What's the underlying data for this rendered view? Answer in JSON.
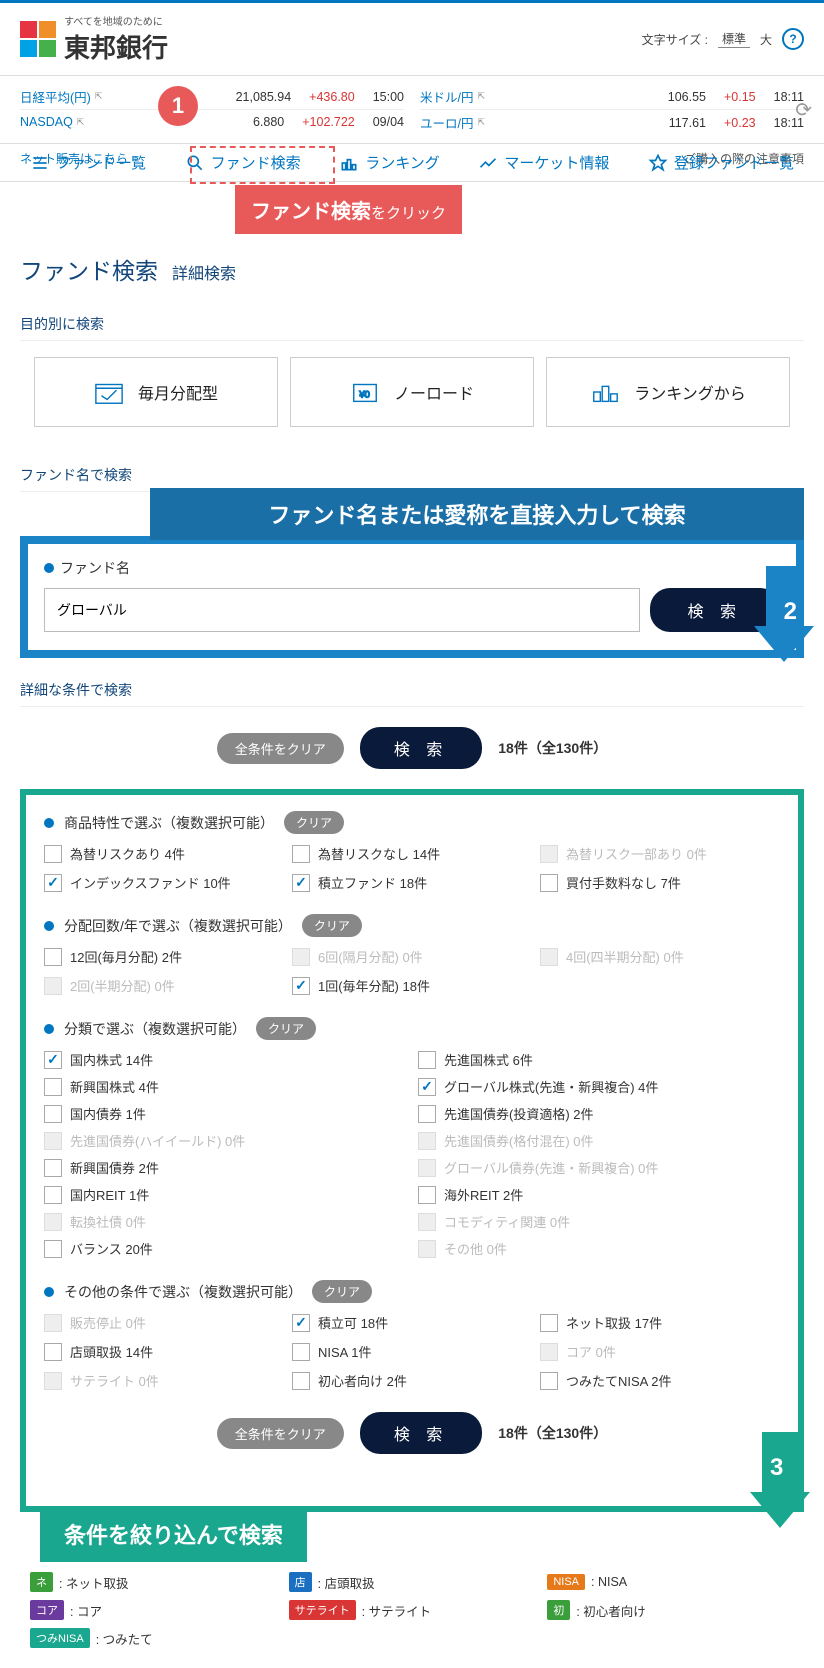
{
  "header": {
    "subtitle": "すべてを地域のために",
    "bank": "東邦銀行",
    "text_size_label": "文字サイズ :",
    "std": "標準",
    "large": "大"
  },
  "market": {
    "rows_left": [
      {
        "name": "日経平均(円)",
        "val": "21,085.94",
        "chg": "+436.80",
        "time": "15:00"
      },
      {
        "name": "NASDAQ",
        "val": "6.880",
        "chg": "+102.722",
        "time": "09/04"
      }
    ],
    "rows_right": [
      {
        "name": "米ドル/円",
        "val": "106.55",
        "chg": "+0.15",
        "time": "18:11"
      },
      {
        "name": "ユーロ/円",
        "val": "117.61",
        "chg": "+0.23",
        "time": "18:11"
      }
    ]
  },
  "nav": {
    "items": [
      "ファンド一覧",
      "ファンド検索",
      "ランキング",
      "マーケット情報",
      "登録ファンド一覧"
    ]
  },
  "annot": {
    "n1": "1",
    "callout1_a": "ファンド検索",
    "callout1_b": "をクリック",
    "callout2": "ファンド名または愛称を直接入力して検索",
    "n2": "2",
    "callout3": "条件を絞り込んで検索",
    "n3": "3"
  },
  "subbar": {
    "left": "ネット販売はこちら",
    "right": "ご購入の際の注意事項"
  },
  "titles": {
    "h1": "ファンド検索",
    "h1sub": "詳細検索",
    "purpose": "目的別に検索",
    "byname": "ファンド名で検索",
    "detail": "詳細な条件で検索"
  },
  "purpose": {
    "p1": "毎月分配型",
    "p2": "ノーロード",
    "p3": "ランキングから"
  },
  "fundname": {
    "label": "ファンド名",
    "value": "グローバル",
    "btn": "検 索"
  },
  "actions": {
    "clear": "全条件をクリア",
    "search": "検 索",
    "count": "18件（全130件）"
  },
  "filters": {
    "g1": {
      "title": "商品特性で選ぶ（複数選択可能）",
      "clr": "クリア",
      "opts": [
        {
          "t": "為替リスクあり  4件",
          "c": false,
          "d": false
        },
        {
          "t": "為替リスクなし  14件",
          "c": false,
          "d": false
        },
        {
          "t": "為替リスク一部あり  0件",
          "c": false,
          "d": true
        },
        {
          "t": "インデックスファンド  10件",
          "c": true,
          "d": false
        },
        {
          "t": "積立ファンド  18件",
          "c": true,
          "d": false
        },
        {
          "t": "買付手数料なし  7件",
          "c": false,
          "d": false
        }
      ]
    },
    "g2": {
      "title": "分配回数/年で選ぶ（複数選択可能）",
      "clr": "クリア",
      "opts": [
        {
          "t": "12回(毎月分配)  2件",
          "c": false,
          "d": false
        },
        {
          "t": "6回(隔月分配)  0件",
          "c": false,
          "d": true
        },
        {
          "t": "4回(四半期分配)  0件",
          "c": false,
          "d": true
        },
        {
          "t": "2回(半期分配)  0件",
          "c": false,
          "d": true
        },
        {
          "t": "1回(毎年分配)  18件",
          "c": true,
          "d": false
        }
      ]
    },
    "g3": {
      "title": "分類で選ぶ（複数選択可能）",
      "clr": "クリア",
      "opts": [
        {
          "t": "国内株式  14件",
          "c": true,
          "d": false
        },
        {
          "t": "先進国株式  6件",
          "c": false,
          "d": false
        },
        {
          "t": "新興国株式  4件",
          "c": false,
          "d": false
        },
        {
          "t": "グローバル株式(先進・新興複合)  4件",
          "c": true,
          "d": false
        },
        {
          "t": "国内債券  1件",
          "c": false,
          "d": false
        },
        {
          "t": "先進国債券(投資適格)  2件",
          "c": false,
          "d": false
        },
        {
          "t": "先進国債券(ハイイールド)  0件",
          "c": false,
          "d": true
        },
        {
          "t": "先進国債券(格付混在)  0件",
          "c": false,
          "d": true
        },
        {
          "t": "新興国債券  2件",
          "c": false,
          "d": false
        },
        {
          "t": "グローバル債券(先進・新興複合)  0件",
          "c": false,
          "d": true
        },
        {
          "t": "国内REIT  1件",
          "c": false,
          "d": false
        },
        {
          "t": "海外REIT  2件",
          "c": false,
          "d": false
        },
        {
          "t": "転換社債  0件",
          "c": false,
          "d": true
        },
        {
          "t": "コモディティ関連  0件",
          "c": false,
          "d": true
        },
        {
          "t": "バランス  20件",
          "c": false,
          "d": false
        },
        {
          "t": "その他  0件",
          "c": false,
          "d": true
        }
      ]
    },
    "g4": {
      "title": "その他の条件で選ぶ（複数選択可能）",
      "clr": "クリア",
      "opts": [
        {
          "t": "販売停止  0件",
          "c": false,
          "d": true
        },
        {
          "t": "積立可  18件",
          "c": true,
          "d": false
        },
        {
          "t": "ネット取扱  17件",
          "c": false,
          "d": false
        },
        {
          "t": "店頭取扱  14件",
          "c": false,
          "d": false
        },
        {
          "t": "NISA  1件",
          "c": false,
          "d": false
        },
        {
          "t": "コア  0件",
          "c": false,
          "d": true
        },
        {
          "t": "サテライト  0件",
          "c": false,
          "d": true
        },
        {
          "t": "初心者向け  2件",
          "c": false,
          "d": false
        },
        {
          "t": "つみたてNISA  2件",
          "c": false,
          "d": false
        }
      ]
    }
  },
  "legend": [
    {
      "cls": "tag-green",
      "tag": "ネ",
      "txt": ": ネット取扱"
    },
    {
      "cls": "tag-blue",
      "tag": "店",
      "txt": ": 店頭取扱"
    },
    {
      "cls": "tag-orange",
      "tag": "NISA",
      "txt": ": NISA"
    },
    {
      "cls": "tag-purple",
      "tag": "コア",
      "txt": ": コア"
    },
    {
      "cls": "tag-red",
      "tag": "サテライト",
      "txt": ": サテライト"
    },
    {
      "cls": "tag-green",
      "tag": "初",
      "txt": ": 初心者向け"
    },
    {
      "cls": "tag-teal",
      "tag": "つみNISA",
      "txt": ": つみたて"
    }
  ]
}
